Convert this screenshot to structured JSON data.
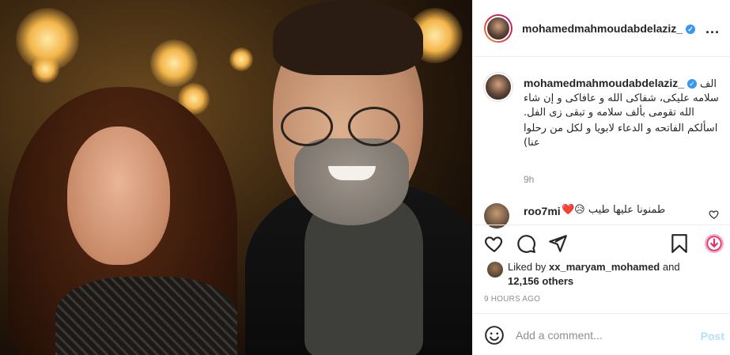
{
  "photo": {
    "description_icon": "post-photo"
  },
  "header": {
    "username": "mohamedmahmoudabdelaziz_",
    "verified_icon": "verified-badge-icon",
    "more_label": "..."
  },
  "caption": {
    "username": "mohamedmahmoudabdelaziz_",
    "line1": "الف",
    "line2": "سلامه عليكى، شفاكى الله و عافاكى و إن شاء الله تقومى بألف سلامه و تبقى زى الفل.",
    "line3": "اسألكم الفاتحه و الدعاء لابويا و لكل من رحلوا عنا)",
    "line4": "(رحلوا عنا)",
    "time": "9h"
  },
  "comment": {
    "username": "roo7mi",
    "text": "طمنونا عليها طيب 😥❤️"
  },
  "actions": {
    "like_icon": "heart-icon",
    "comment_icon": "comment-icon",
    "share_icon": "paper-plane-icon",
    "save_icon": "bookmark-icon",
    "download_icon": "download-icon"
  },
  "likes": {
    "prefix": "Liked by ",
    "user": "xx_maryam_mohamed",
    "middle": " and",
    "count": "12,156 others"
  },
  "posted": "9 HOURS AGO",
  "add_comment": {
    "placeholder": "Add a comment...",
    "post_label": "Post",
    "emoji_icon": "smiley-icon"
  },
  "colors": {
    "accent": "#3897f0",
    "post_disabled": "#b2dffc",
    "muted": "#8e8e8e",
    "text": "#262626",
    "download": "#e1306c"
  }
}
